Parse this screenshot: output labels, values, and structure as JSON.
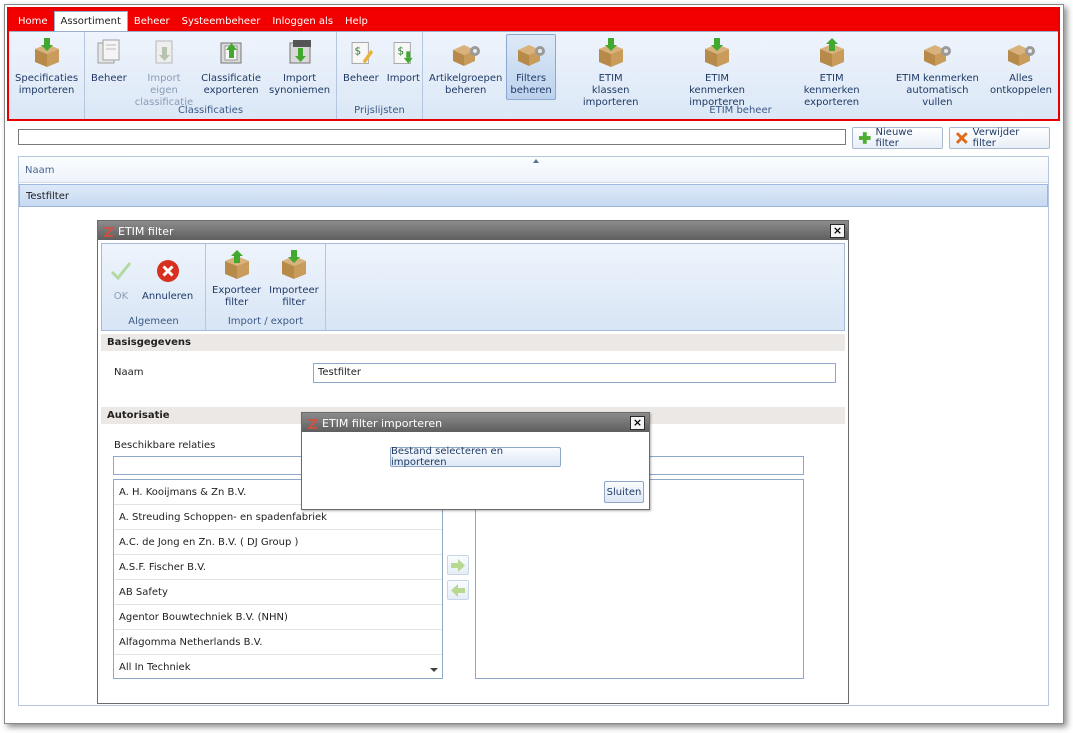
{
  "ribbon": {
    "tabs": [
      "Home",
      "Assortiment",
      "Beheer",
      "Systeembeheer",
      "Inloggen als",
      "Help"
    ],
    "active_tab": "Assortiment",
    "specificaties": {
      "label1": "Specificaties",
      "label2": "importeren"
    },
    "classificaties": {
      "group_label": "Classificaties",
      "beheer": "Beheer",
      "import_eigen": {
        "l1": "Import eigen",
        "l2": "classificatie"
      },
      "classificatie_exporteren": {
        "l1": "Classificatie",
        "l2": "exporteren"
      },
      "import_synoniemen": {
        "l1": "Import",
        "l2": "synoniemen"
      }
    },
    "prijslijsten": {
      "group_label": "Prijslijsten",
      "beheer": "Beheer",
      "import": "Import"
    },
    "etim": {
      "group_label": "ETIM beheer",
      "artikelgroepen": {
        "l1": "Artikelgroepen",
        "l2": "beheren"
      },
      "filters": {
        "l1": "Filters",
        "l2": "beheren"
      },
      "klassen": {
        "l1": "ETIM",
        "l2": "klassen importeren"
      },
      "kenmerken_imp": {
        "l1": "ETIM",
        "l2": "kenmerken importeren"
      },
      "kenmerken_exp": {
        "l1": "ETIM",
        "l2": "kenmerken exporteren"
      },
      "auto": {
        "l1": "ETIM kenmerken",
        "l2": "automatisch vullen"
      },
      "ontkoppelen": {
        "l1": "Alles",
        "l2": "ontkoppelen"
      }
    }
  },
  "toolbar": {
    "search_value": "",
    "new_filter": "Nieuwe filter",
    "delete_filter": "Verwijder filter"
  },
  "grid": {
    "header": "Naam",
    "rows": [
      "Testfilter"
    ]
  },
  "filter_dialog": {
    "title": "ETIM filter",
    "ok": "OK",
    "cancel": "Annuleren",
    "group_algemeen": "Algemeen",
    "export": {
      "l1": "Exporteer",
      "l2": "filter"
    },
    "import": {
      "l1": "Importeer",
      "l2": "filter"
    },
    "group_import_export": "Import / export",
    "section_basis": "Basisgegevens",
    "name_label": "Naam",
    "name_value": "Testfilter",
    "section_autorisatie": "Autorisatie",
    "available_label": "Beschikbare relaties",
    "available_search": "",
    "selected_search": "",
    "relations": [
      "A. H. Kooijmans & Zn B.V.",
      "A. Streuding Schoppen- en spadenfabriek",
      "A.C. de Jong en Zn. B.V. ( DJ Group )",
      "A.S.F. Fischer B.V.",
      "AB Safety",
      "Agentor Bouwtechniek B.V. (NHN)",
      "Alfagomma Netherlands B.V.",
      "All In Techniek"
    ]
  },
  "import_dialog": {
    "title": "ETIM filter importeren",
    "select_button": "Bestand selecteren en importeren",
    "close_button": "Sluiten"
  },
  "colors": {
    "accent_red": "#f20000",
    "ribbon_blue": "#dbe7f6",
    "selection": "#c7daf2"
  }
}
